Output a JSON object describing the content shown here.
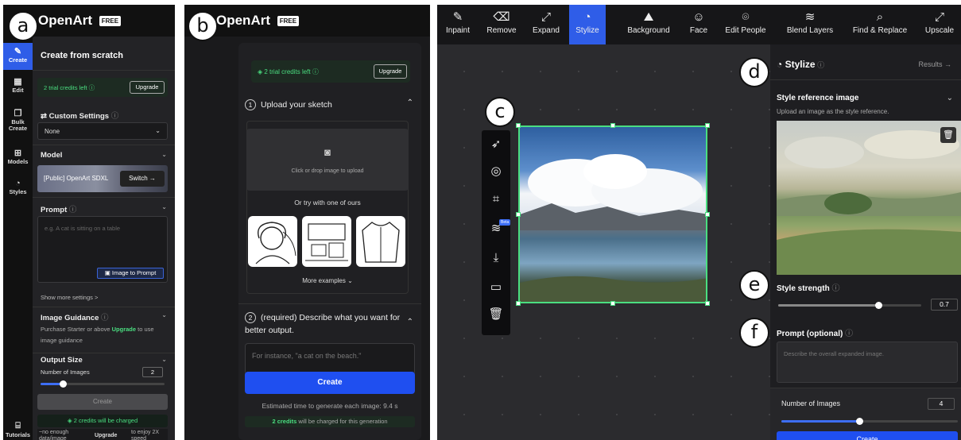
{
  "panel_a": {
    "logo": "OpenArt",
    "free": "FREE",
    "rail": [
      {
        "icon": "create-icon",
        "label": "Create"
      },
      {
        "icon": "edit-icon",
        "label": "Edit"
      },
      {
        "icon": "bulk-icon",
        "label": "Bulk Create"
      },
      {
        "icon": "models-icon",
        "label": "Models"
      },
      {
        "icon": "styles-icon",
        "label": "Styles"
      }
    ],
    "tutorials": "Tutorials",
    "title": "Create from scratch",
    "credits": "2 trial credits left ⓘ",
    "upgrade": "Upgrade",
    "custom_settings": "Custom Settings",
    "custom_value": "None",
    "model_label": "Model",
    "model_name": "[Public] OpenArt SDXL",
    "switch": "Switch →",
    "prompt_label": "Prompt",
    "prompt_placeholder": "e.g. A cat is sitting on a table",
    "image_to_prompt": "Image to Prompt",
    "show_more": "Show more settings >",
    "guidance_label": "Image Guidance",
    "guidance_desc_1": "Purchase Starter or above ",
    "guidance_desc_link": "Upgrade",
    "guidance_desc_2": " to use image guidance",
    "output_size": "Output Size",
    "num_images_label": "Number of Images",
    "num_images": "2",
    "num_images_fraction": 0.18,
    "create": "Create",
    "charged": "2 credits will be charged",
    "bottom_left": "~no enough data/image",
    "bottom_upgrade": "Upgrade",
    "bottom_right": "to enjoy 2X speed"
  },
  "panel_b": {
    "logo": "OpenArt",
    "free": "FREE",
    "credits": "2 trial credits left ⓘ",
    "upgrade": "Upgrade",
    "step1_num": "1",
    "step1": "Upload your sketch",
    "upload_text": "Click or drop image to upload",
    "or_try": "Or try with one of ours",
    "more_examples": "More examples",
    "step2_num": "2",
    "step2": "(required) Describe what you want for better output.",
    "describe_placeholder": "For instance, \"a cat on the beach.\"",
    "create": "Create",
    "estimate": "Estimated time to generate each image: 9.4 s",
    "charged_hl": "2 credits",
    "charged_rest": " will be charged for this generation"
  },
  "panel_c": {
    "tools": [
      {
        "icon": "inpaint-icon",
        "label": "Inpaint"
      },
      {
        "icon": "remove-icon",
        "label": "Remove"
      },
      {
        "icon": "expand-icon",
        "label": "Expand"
      },
      {
        "icon": "stylize-icon",
        "label": "Stylize"
      },
      {
        "icon": "background-icon",
        "label": "Background"
      },
      {
        "icon": "face-icon",
        "label": "Face"
      },
      {
        "icon": "edit-people-icon",
        "label": "Edit People"
      },
      {
        "icon": "blend-layers-icon",
        "label": "Blend Layers"
      },
      {
        "icon": "find-replace-icon",
        "label": "Find & Replace"
      },
      {
        "icon": "upscale-icon",
        "label": "Upscale"
      }
    ],
    "active_tool": "Stylize",
    "beta": "Beta",
    "side_title": "Stylize",
    "results": "Results →",
    "style_ref": "Style reference image",
    "style_ref_desc": "Upload an image as the style reference.",
    "strength_label": "Style strength",
    "strength_value": "0.7",
    "strength_fraction": 0.7,
    "prompt_label": "Prompt (optional)",
    "prompt_placeholder": "Describe the overall expanded image.",
    "num_images_label": "Number of Images",
    "num_images": "4",
    "num_images_fraction": 0.44,
    "create": "Create"
  },
  "labels": [
    "a",
    "b",
    "c",
    "d",
    "e",
    "f"
  ]
}
